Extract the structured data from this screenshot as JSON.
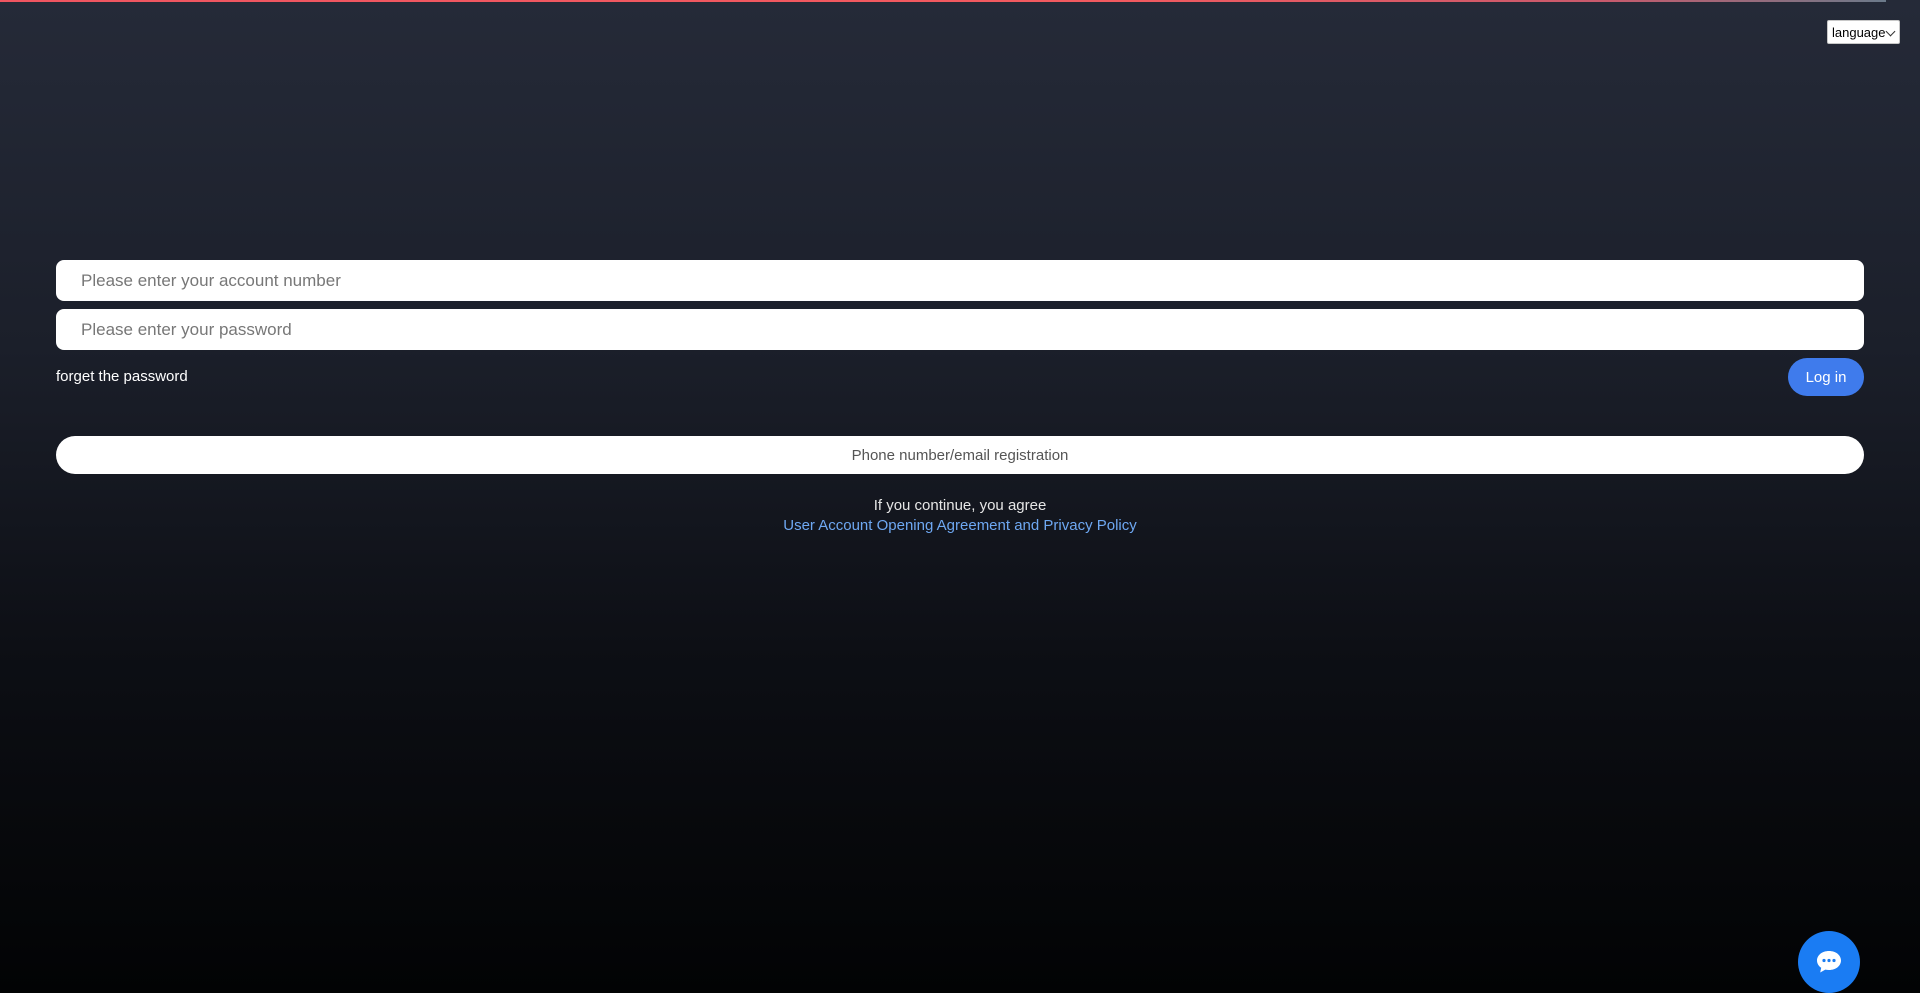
{
  "header": {
    "language_label": "language"
  },
  "login_form": {
    "account_placeholder": "Please enter your account number",
    "account_value": "",
    "password_placeholder": "Please enter your password",
    "password_value": "",
    "forget_label": "forget the password",
    "login_label": "Log in"
  },
  "registration": {
    "button_label": "Phone number/email registration"
  },
  "agreement": {
    "intro_text": "If you continue, you agree",
    "link_text": "User Account Opening Agreement and Privacy Policy"
  },
  "chat": {
    "icon": "chat-bubble-icon"
  },
  "colors": {
    "accent_blue": "#3f7bec",
    "link_blue": "#6ea8f2",
    "chat_blue": "#1a7cf3",
    "top_line": "#f05560"
  }
}
